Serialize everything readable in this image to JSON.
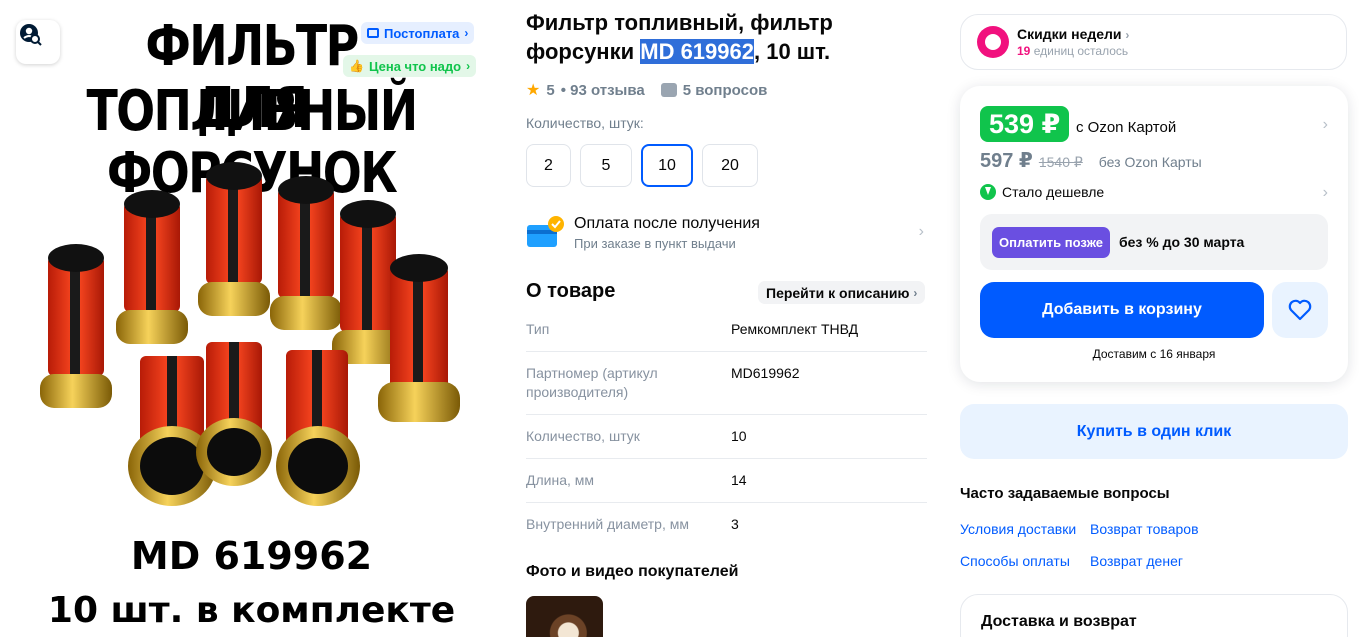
{
  "product_image": {
    "headline_line1": "ФИЛЬТР ТОПЛИВНЫЙ",
    "headline_line2": "ДЛЯ ФОРСУНОК",
    "bottom_line1": "MD 619962",
    "bottom_line2": "10 шт. в комплекте",
    "badges": {
      "postpay": "Постоплата",
      "fair_price": "Цена что надо"
    },
    "filter_colors": {
      "mesh": "#e8391c",
      "cap": "#1a1a1a",
      "ring": "#d4a017"
    }
  },
  "product": {
    "title_before": "Фильтр топливный, фильтр форсунки ",
    "title_highlight": "MD 619962",
    "title_after": ", 10 шт.",
    "rating": "5",
    "reviews": "• 93 отзыва",
    "questions": "5 вопросов"
  },
  "quantity": {
    "label": "Количество, штук:",
    "options": [
      "2",
      "5",
      "10",
      "20"
    ],
    "selected": "10"
  },
  "pay_after_receipt": {
    "title": "Оплата после получения",
    "subtitle": "При заказе в пункт выдачи"
  },
  "about": {
    "title": "О товаре",
    "link": "Перейти к описанию",
    "specs": [
      {
        "key": "Тип",
        "value": "Ремкомплект ТНВД"
      },
      {
        "key": "Партномер (артикул производителя)",
        "value": "MD619962"
      },
      {
        "key": "Количество, штук",
        "value": "10"
      },
      {
        "key": "Длина, мм",
        "value": "14"
      },
      {
        "key": "Внутренний диаметр, мм",
        "value": "3"
      }
    ]
  },
  "photos": {
    "title": "Фото и видео покупателей"
  },
  "discounts": {
    "title": "Скидки недели",
    "remaining_count": "19",
    "remaining_text": "единиц осталось"
  },
  "price": {
    "card_price": "539 ₽",
    "card_label": "с Ozon Картой",
    "price": "597 ₽",
    "old_price": "1540 ₽",
    "no_card_label": "без Ozon Карты",
    "cheaper": "Стало дешевле",
    "pay_later_button": "Оплатить позже",
    "pay_later_text": "без % до 30 марта",
    "add_to_cart": "Добавить в корзину",
    "delivery": "Доставим с 16 января"
  },
  "one_click": "Купить в один клик",
  "faq": {
    "title": "Часто задаваемые вопросы",
    "links": [
      "Условия доставки",
      "Возврат товаров",
      "Способы оплаты",
      "Возврат денег"
    ]
  },
  "delivery_return": {
    "title": "Доставка и возврат"
  },
  "colors": {
    "accent": "#005bff",
    "green": "#10c44c",
    "pink": "#f1117e",
    "purple": "#6a4fe1"
  }
}
